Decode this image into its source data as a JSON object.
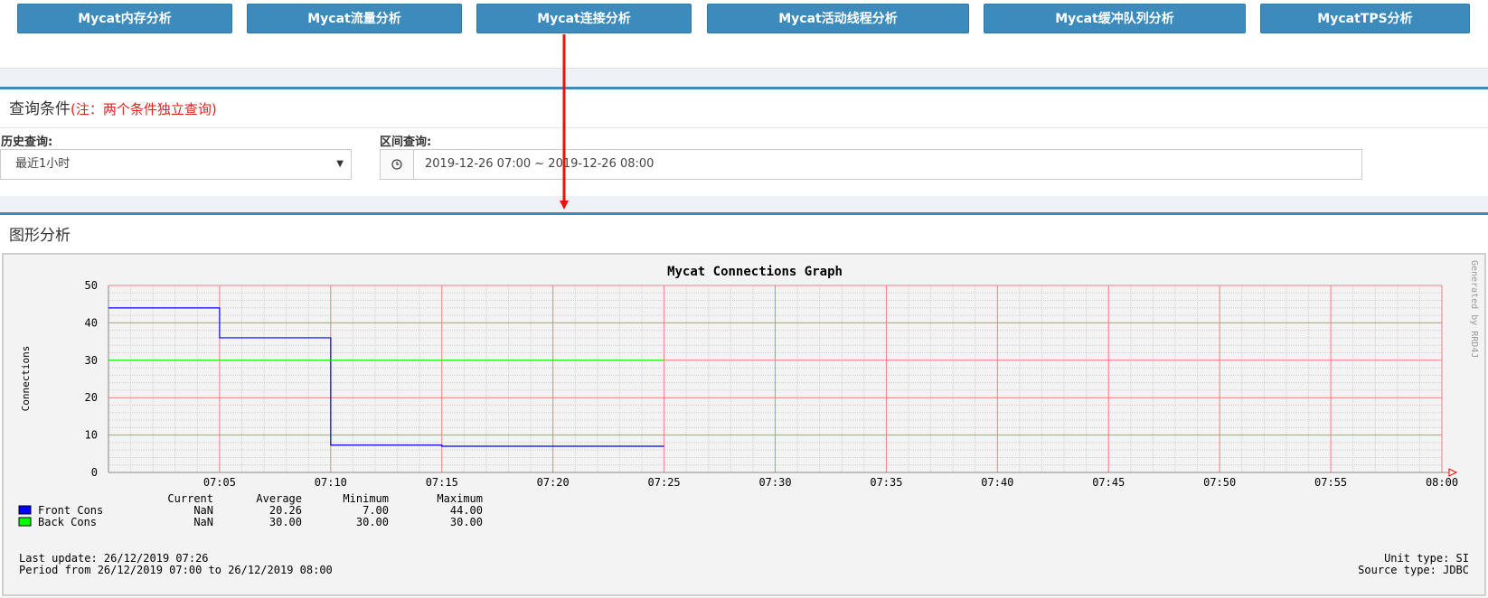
{
  "tabs": [
    {
      "label": "Mycat内存分析"
    },
    {
      "label": "Mycat流量分析"
    },
    {
      "label": "Mycat连接分析"
    },
    {
      "label": "Mycat活动线程分析"
    },
    {
      "label": "Mycat缓冲队列分析"
    },
    {
      "label": "MycatTPS分析"
    }
  ],
  "query": {
    "title": "查询条件",
    "note": "(注：两个条件独立查询)",
    "history_label": "历史查询:",
    "history_value": "最近1小时",
    "range_label": "区间查询:",
    "range_value": "2019-12-26 07:00 ~ 2019-12-26 08:00",
    "clock_icon": "clock-icon"
  },
  "graph": {
    "title": "图形分析"
  },
  "chart_data": {
    "type": "line",
    "title": "Mycat Connections Graph",
    "ylabel": "Connections",
    "xlabel": "",
    "watermark": "Generated by RRD4J",
    "ylim": [
      0,
      50
    ],
    "yticks": [
      0,
      10,
      20,
      30,
      40,
      50
    ],
    "xlim": [
      "07:00",
      "08:00"
    ],
    "xticks": [
      "07:05",
      "07:10",
      "07:15",
      "07:20",
      "07:25",
      "07:30",
      "07:35",
      "07:40",
      "07:45",
      "07:50",
      "07:55",
      "08:00"
    ],
    "grid": true,
    "legend_placement": "bottom-left",
    "series": [
      {
        "name": "Front Cons",
        "color": "#0000ff",
        "x": [
          "07:00",
          "07:05",
          "07:05",
          "07:10",
          "07:10",
          "07:15",
          "07:15",
          "07:25"
        ],
        "values": [
          44,
          44,
          36,
          36,
          7.3,
          7.3,
          7,
          7
        ],
        "stats": {
          "current": "NaN",
          "average": "20.26",
          "minimum": "7.00",
          "maximum": "44.00"
        }
      },
      {
        "name": "Back Cons",
        "color": "#00ff00",
        "x": [
          "07:00",
          "07:25"
        ],
        "values": [
          30,
          30
        ],
        "stats": {
          "current": "NaN",
          "average": "30.00",
          "minimum": "30.00",
          "maximum": "30.00"
        }
      }
    ],
    "legend_headers": [
      "Current",
      "Average",
      "Minimum",
      "Maximum"
    ],
    "footer": {
      "last_update": "Last update: 26/12/2019 07:26",
      "period": "Period from 26/12/2019 07:00 to 26/12/2019 08:00",
      "unit_type": "Unit type: SI",
      "source_type": "Source type: JDBC"
    }
  },
  "colors": {
    "accent": "#3d8bbd",
    "note": "#e5211b",
    "annotation_arrow": "#e8140c"
  }
}
